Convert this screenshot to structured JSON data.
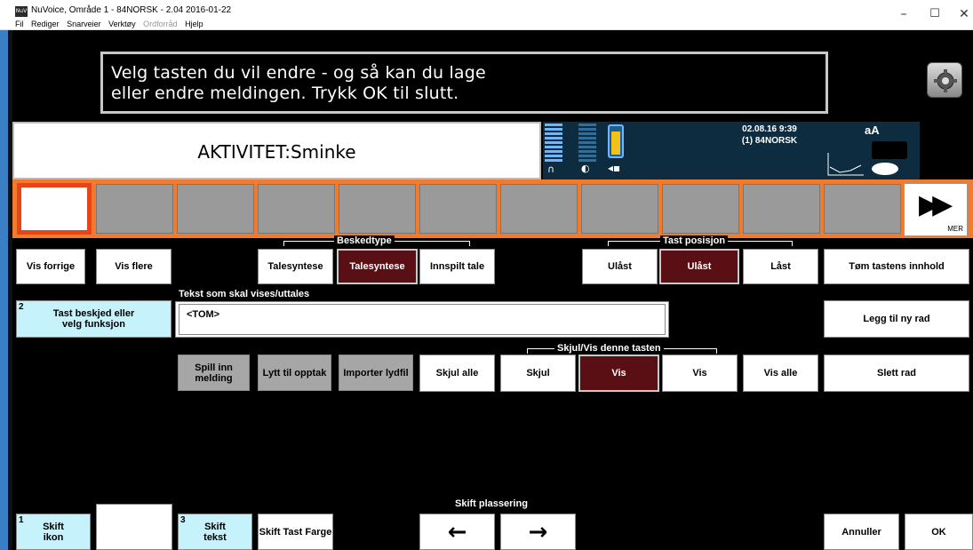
{
  "window": {
    "title": "NuVoice, Område 1 - 84NORSK - 2.04 2016-01-22",
    "icon_label": "NuV",
    "menu": [
      "Fil",
      "Rediger",
      "Snarveier",
      "Verktøy",
      "Ordforråd",
      "Hjelp"
    ],
    "controls": {
      "minimize": "–",
      "maximize": "☐",
      "close": "✕"
    }
  },
  "instruction": {
    "line1": "Velg tasten du vil endre - og så kan du lage",
    "line2": "eller endre meldingen. Trykk OK til slutt."
  },
  "activity": {
    "label": "AKTIVITET:Sminke"
  },
  "status": {
    "date": "02.08.16 9:39",
    "profile": "(1) 84NORSK",
    "font_indicator": "aA"
  },
  "strip": {
    "more_label": "MER"
  },
  "nav": {
    "prev": "Vis forrige",
    "next": "Vis flere"
  },
  "message_type": {
    "title": "Beskedtype",
    "options": [
      "Talesyntese",
      "Talesyntese",
      "Innspilt tale"
    ]
  },
  "key_position": {
    "title": "Tast posisjon",
    "options": [
      "Ulåst",
      "Ulåst",
      "Låst"
    ]
  },
  "clear_key": "Tøm tastens innhold",
  "text_label": "Tekst som skal vises/uttales",
  "text_value": "<TOM>",
  "message_button": {
    "num": "2",
    "label": "Tast beskjed eller velg funksjon"
  },
  "add_row": "Legg til ny rad",
  "record": {
    "record": "Spill inn melding",
    "listen": "Lytt til opptak",
    "import": "Importer lydfil"
  },
  "hide_all": "Skjul alle",
  "visibility": {
    "title": "Skjul/Vis denne tasten",
    "options": [
      "Skjul",
      "Vis",
      "Vis"
    ],
    "show_all": "Vis alle"
  },
  "delete_row": "Slett rad",
  "bottom": {
    "icon": {
      "num": "1",
      "label": "Skift ikon"
    },
    "text": {
      "num": "3",
      "label": "Skift tekst"
    },
    "color": "Skift Tast Farge",
    "position_label": "Skift plassering",
    "left_arrow": "←",
    "right_arrow": "→",
    "cancel": "Annuller",
    "ok": "OK"
  },
  "colors": {
    "dark_red": "#5a0f14",
    "cyan": "#c6f2fb",
    "orange": "#f07b2e",
    "status_bg": "#0d2c40"
  }
}
